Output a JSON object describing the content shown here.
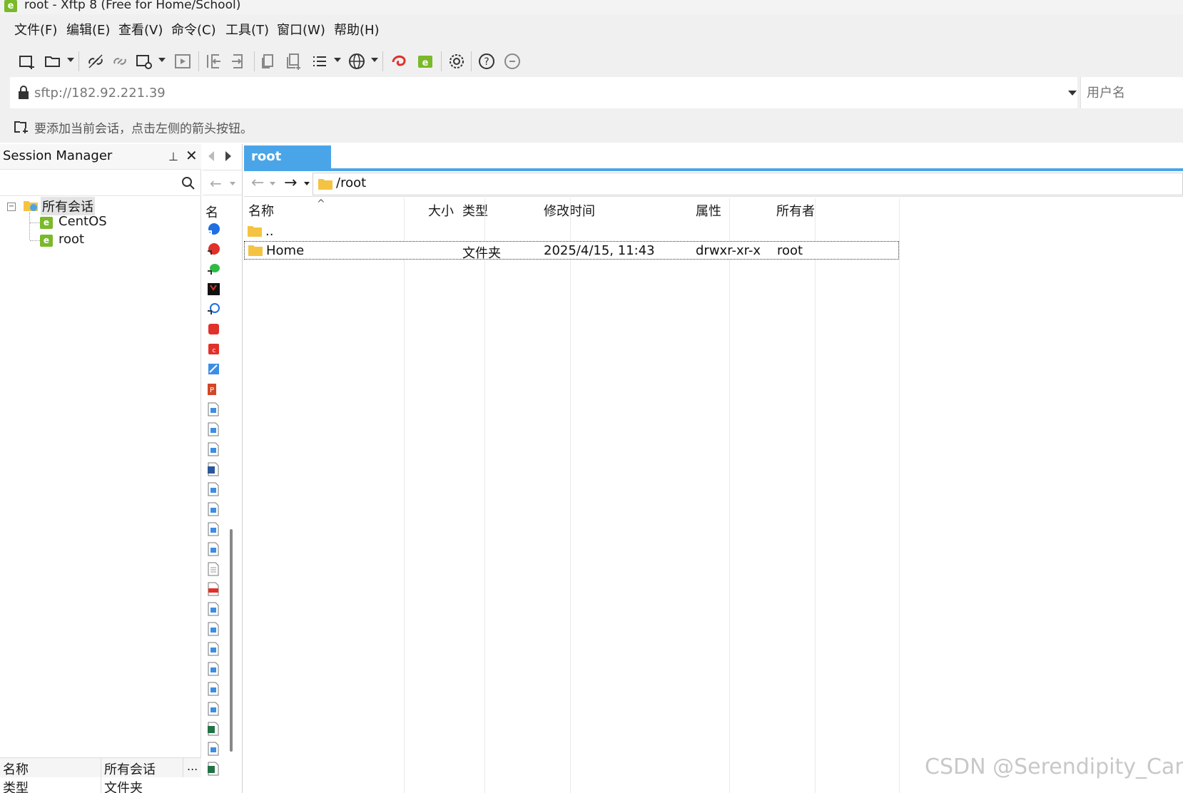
{
  "window": {
    "title": "root - Xftp 8 (Free for Home/School)",
    "app_icon_glyph": "e"
  },
  "menu": [
    "文件(F)",
    "编辑(E)",
    "查看(V)",
    "命令(C)",
    "工具(T)",
    "窗口(W)",
    "帮助(H)"
  ],
  "toolbar": {
    "icons": [
      "new-session-icon",
      "open-folder-icon",
      "disconnect-icon",
      "link-icon",
      "session-settings-icon",
      "play-icon",
      "import-icon",
      "export-icon",
      "copy-icon",
      "duplicate-icon",
      "list-view-icon",
      "globe-icon",
      "xshell-icon",
      "xftp-icon",
      "settings-gear-icon",
      "help-icon",
      "chat-icon"
    ]
  },
  "address": {
    "url": "sftp://182.92.221.39",
    "username_placeholder": "用户名"
  },
  "hint": {
    "text": "要添加当前会话，点击左侧的箭头按钮。"
  },
  "session_manager": {
    "title": "Session Manager",
    "pin_glyph": "⊥",
    "close_glyph": "✕",
    "tree": {
      "root_label": "所有会话",
      "children": [
        "CentOS",
        "root"
      ]
    },
    "properties": {
      "header_name": "名称",
      "header_value": "所有会话",
      "header_more": "...",
      "row_name": "类型",
      "row_value": "文件夹"
    }
  },
  "local": {
    "column_header": "名"
  },
  "remote": {
    "tab_label": "root",
    "path": "/root",
    "columns": [
      "名称",
      "大小",
      "类型",
      "修改时间",
      "属性",
      "所有者"
    ],
    "sort_indicator": "^",
    "rows": [
      {
        "name": "..",
        "size": "",
        "type": "",
        "modified": "",
        "attrs": "",
        "owner": ""
      },
      {
        "name": "Home",
        "size": "",
        "type": "文件夹",
        "modified": "2025/4/15, 11:43",
        "attrs": "drwxr-xr-x",
        "owner": "root"
      }
    ]
  },
  "watermark": "CSDN @Serendipity_Carl"
}
